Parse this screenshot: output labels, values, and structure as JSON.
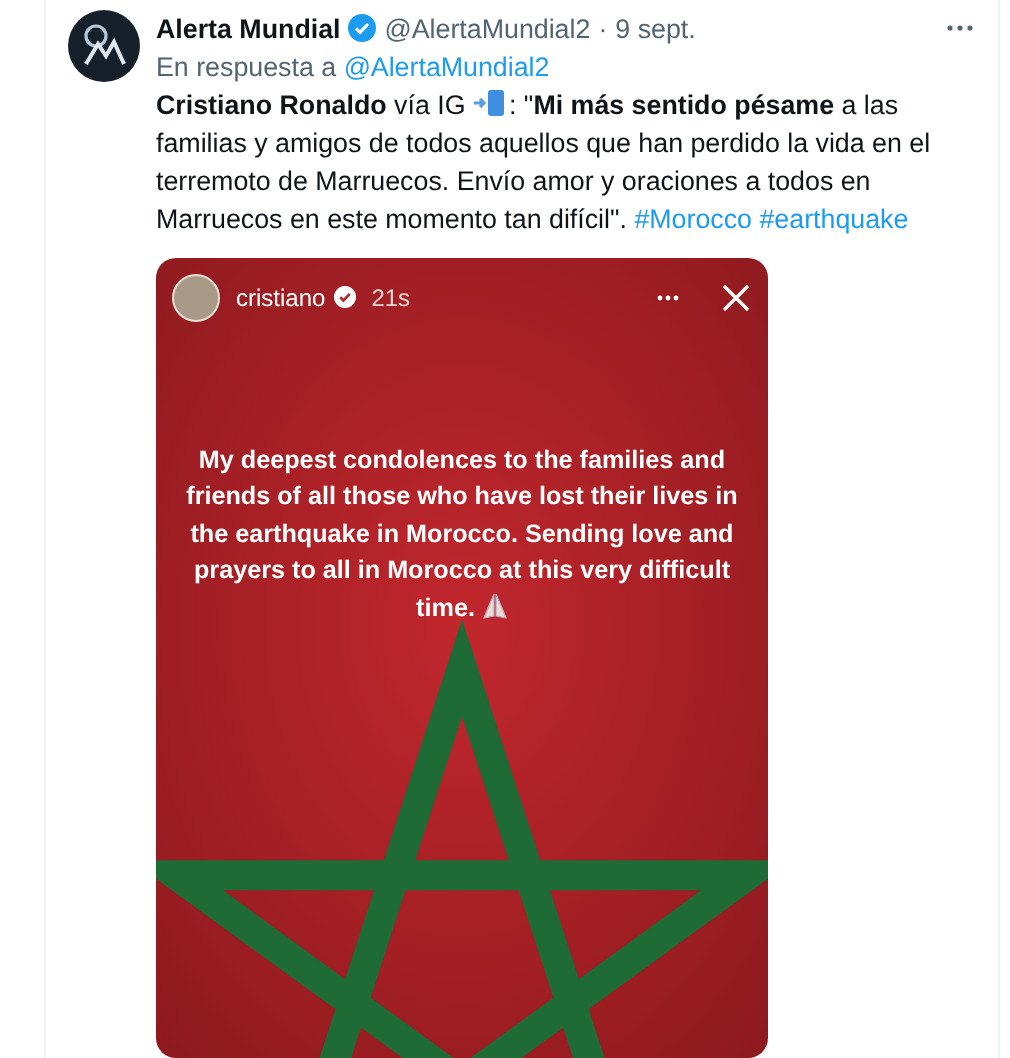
{
  "tweet": {
    "author": "Alerta Mundial",
    "verified": true,
    "handle": "@AlertaMundial2",
    "separator": "·",
    "time": "9 sept.",
    "reply_prefix": "En respuesta a",
    "reply_to": "@AlertaMundial2",
    "text_lead": "**Cristiano Ronaldo** vía IG ",
    "text_main": ": \"**Mi más sentido pésame** a las familias y amigos de todos aquellos que han perdido la vida en el terremoto de Marruecos. Envío amor y oraciones a todos en Marruecos en este momento tan difícil\". ",
    "hashtags": [
      "#Morocco",
      "#earthquake"
    ]
  },
  "story": {
    "user": "cristiano",
    "verified": true,
    "age": "21s",
    "message": "My deepest condolences to the families and friends of all those who have lost their lives in the earthquake in Morocco. Sending love and prayers to all in Morocco at this very difficult time."
  }
}
